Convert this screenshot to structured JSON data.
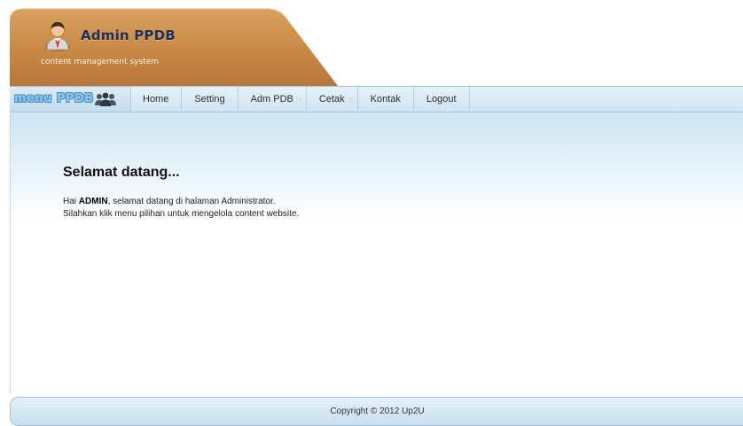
{
  "header": {
    "title": "Admin PPDB",
    "subtitle": "content management system",
    "avatar_icon": "admin-avatar-icon",
    "tab_color": "#c88a45"
  },
  "nav": {
    "logo_text": "menu PPDB",
    "logo_icon": "people-icon",
    "items": [
      {
        "label": "Home",
        "dropdown": false
      },
      {
        "label": "Setting",
        "dropdown": true
      },
      {
        "label": "Adm PDB",
        "dropdown": true
      },
      {
        "label": "Cetak",
        "dropdown": true
      },
      {
        "label": "Kontak",
        "dropdown": false
      },
      {
        "label": "Logout",
        "dropdown": false
      }
    ],
    "bar_color": "#d6e8f4"
  },
  "main": {
    "heading": "Selamat datang...",
    "line1_prefix": "Hai ",
    "line1_user": "ADMIN",
    "line1_suffix": ", selamat datang di halaman Administrator.",
    "line2": "Silahkan klik menu pilihan untuk mengelola content website."
  },
  "footer": {
    "copyright": "Copyright © 2012 Up2U"
  }
}
